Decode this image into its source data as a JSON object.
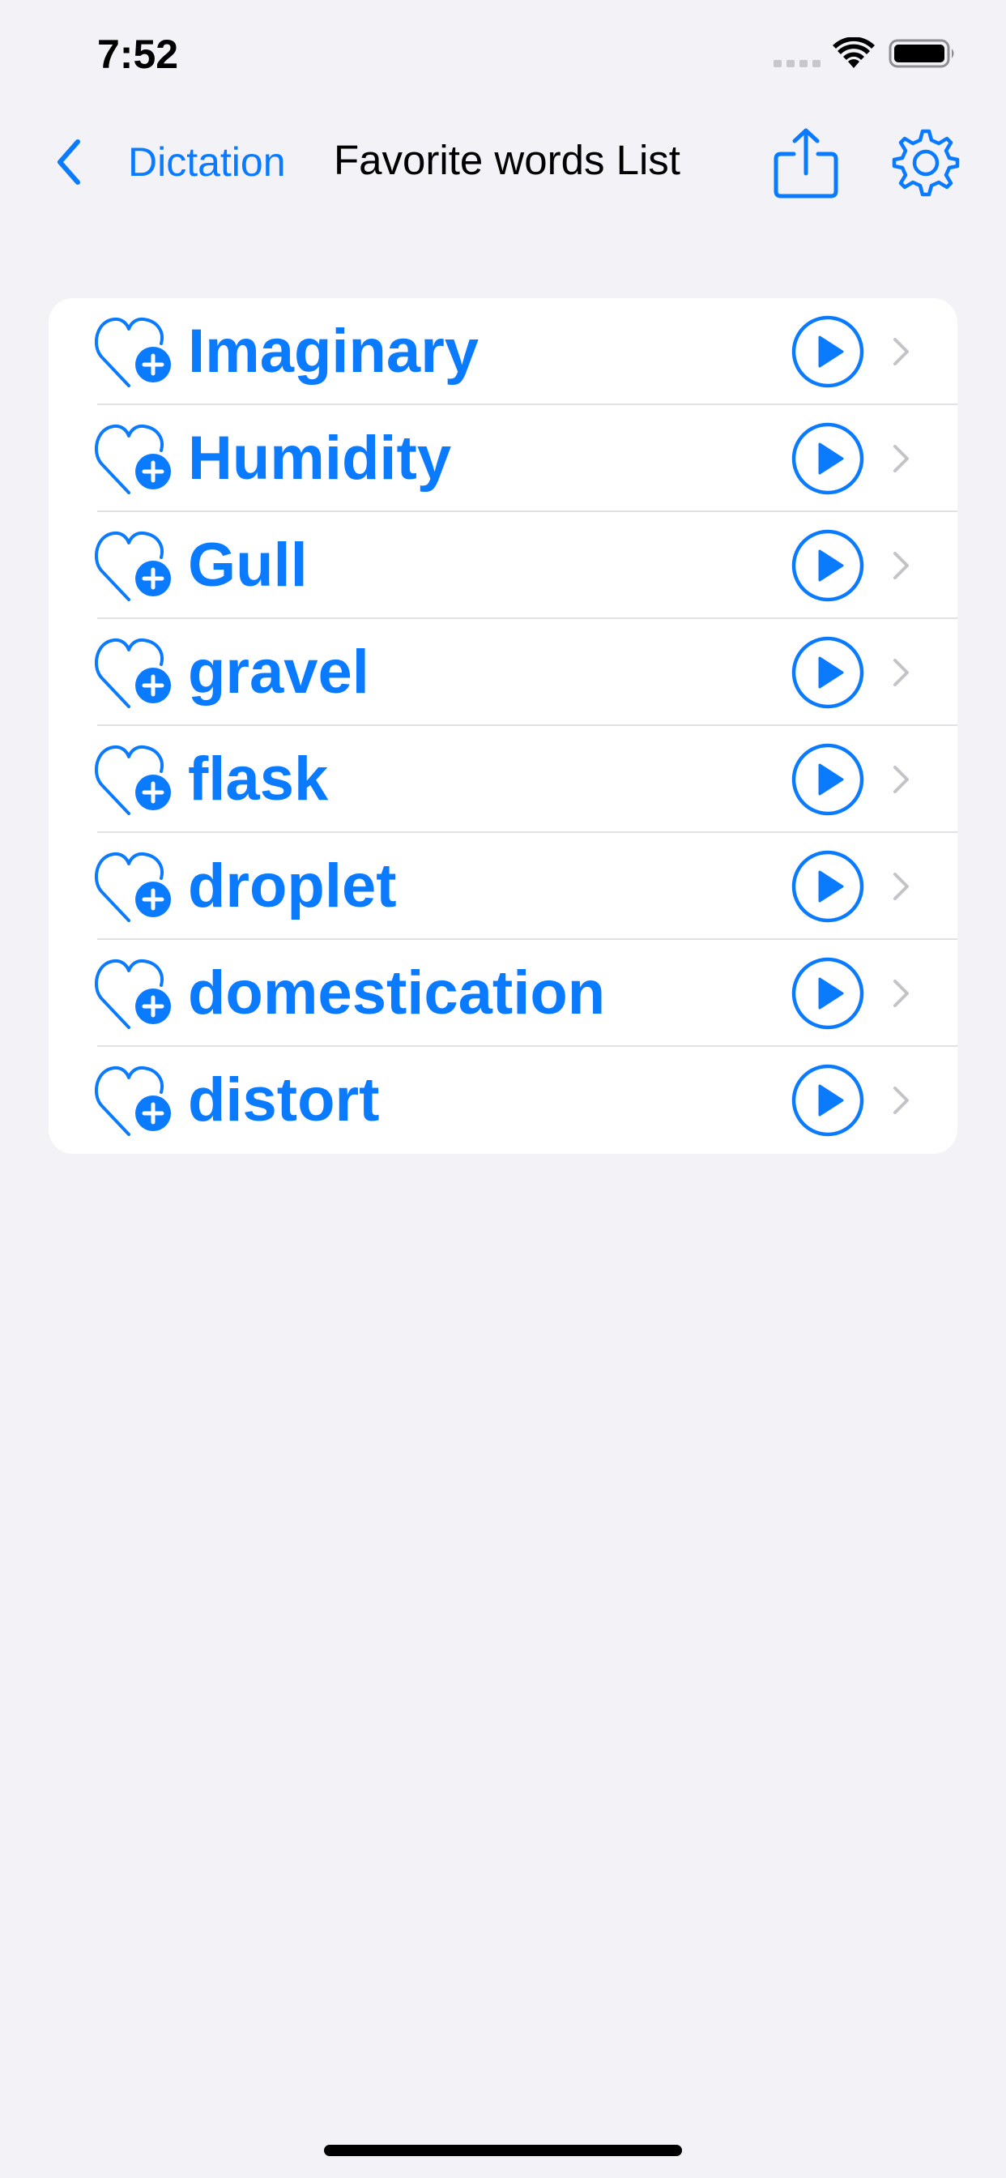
{
  "status_bar": {
    "time": "7:52"
  },
  "nav": {
    "back_label": "Dictation",
    "title": "Favorite words List",
    "icons": {
      "back": "chevron-left-icon",
      "share": "share-icon",
      "settings": "gear-icon"
    }
  },
  "words": [
    {
      "text": "Imaginary"
    },
    {
      "text": "Humidity"
    },
    {
      "text": "Gull"
    },
    {
      "text": "gravel"
    },
    {
      "text": "flask"
    },
    {
      "text": "droplet"
    },
    {
      "text": "domestication"
    },
    {
      "text": "distort"
    }
  ],
  "row_icons": {
    "favorite": "heart-plus-icon",
    "play": "play-circle-icon",
    "disclosure": "chevron-right-icon"
  },
  "colors": {
    "accent": "#0a7aff",
    "background": "#f2f2f7",
    "card": "#ffffff",
    "separator": "#e0e0e5",
    "chevron": "#c4c4c8"
  }
}
